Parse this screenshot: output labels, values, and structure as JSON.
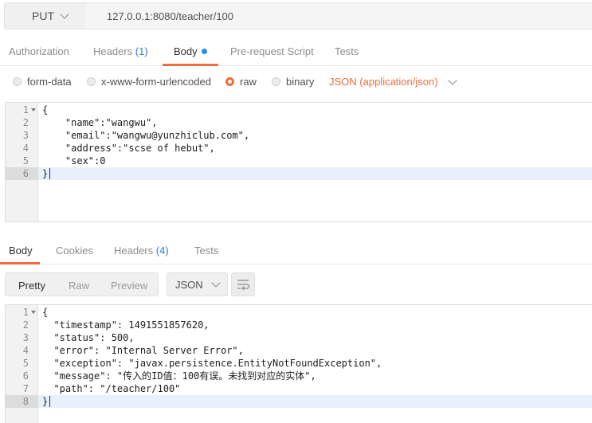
{
  "request": {
    "method": "PUT",
    "url": "127.0.0.1:8080/teacher/100",
    "tabs": {
      "authorization": "Authorization",
      "headers": "Headers",
      "headers_count": "(1)",
      "body": "Body",
      "prerequest": "Pre-request Script",
      "tests": "Tests",
      "active": "Body"
    },
    "body_types": {
      "form_data": "form-data",
      "urlencoded": "x-www-form-urlencoded",
      "raw": "raw",
      "binary": "binary",
      "selected": "raw",
      "content_type": "JSON (application/json)"
    },
    "body_lines": [
      "{",
      "    \"name\":\"wangwu\",",
      "    \"email\":\"wangwu@yunzhiclub.com\",",
      "    \"address\":\"scse of hebut\",",
      "    \"sex\":0",
      "}"
    ]
  },
  "response": {
    "tabs": {
      "body": "Body",
      "cookies": "Cookies",
      "headers": "Headers",
      "headers_count": "(4)",
      "tests": "Tests",
      "active": "Body"
    },
    "views": {
      "pretty": "Pretty",
      "raw": "Raw",
      "preview": "Preview",
      "active": "Pretty"
    },
    "format": "JSON",
    "body_lines": [
      "{",
      "  \"timestamp\": 1491551857620,",
      "  \"status\": 500,",
      "  \"error\": \"Internal Server Error\",",
      "  \"exception\": \"javax.persistence.EntityNotFoundException\",",
      "  \"message\": \"传入的ID值：100有误。未找到对应的实体\",",
      "  \"path\": \"/teacher/100\"",
      "}"
    ]
  },
  "colors": {
    "accent": "#f26b3a",
    "link_blue": "#2a7bd4",
    "code_blue": "#1a1aa6"
  },
  "icons": [
    "chevron-down-icon",
    "radio-icon",
    "wrap-lines-icon",
    "fold-arrow-icon"
  ]
}
